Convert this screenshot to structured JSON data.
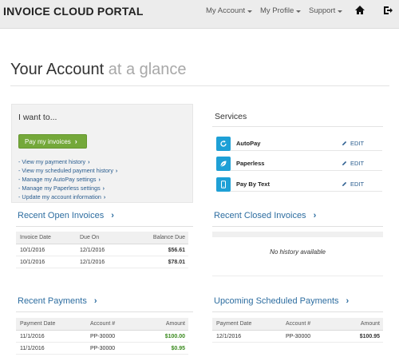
{
  "nav": {
    "brand": "INVOICE CLOUD PORTAL",
    "items": [
      {
        "label": "My Account"
      },
      {
        "label": "My Profile"
      },
      {
        "label": "Support"
      }
    ],
    "icons": {
      "home": "home-icon",
      "logout": "logout-icon"
    }
  },
  "page": {
    "title_main": "Your Account",
    "title_muted": "at a glance"
  },
  "want": {
    "title": "I want to...",
    "pay_button": "Pay my invoices",
    "links": [
      "- View my payment history",
      "- View my scheduled payment history",
      "- Manage my AutoPay settings",
      "- Manage my Paperless settings",
      "- Update my account information"
    ]
  },
  "services": {
    "title": "Services",
    "items": [
      {
        "name": "AutoPay",
        "edit": "EDIT",
        "icon": "refresh-icon"
      },
      {
        "name": "Paperless",
        "edit": "EDIT",
        "icon": "leaf-icon"
      },
      {
        "name": "Pay By Text",
        "edit": "EDIT",
        "icon": "phone-icon"
      }
    ]
  },
  "open_invoices": {
    "title": "Recent Open Invoices",
    "columns": [
      "Invoice Date",
      "Due On",
      "Balance Due"
    ],
    "rows": [
      [
        "10/1/2016",
        "12/1/2016",
        "$56.61"
      ],
      [
        "10/1/2016",
        "12/1/2016",
        "$78.01"
      ]
    ]
  },
  "closed_invoices": {
    "title": "Recent Closed Invoices",
    "empty_text": "No history available"
  },
  "payments": {
    "title": "Recent Payments",
    "columns": [
      "Payment Date",
      "Account #",
      "Amount"
    ],
    "rows": [
      [
        "11/1/2016",
        "PP-30000",
        "$100.00"
      ],
      [
        "11/1/2016",
        "PP-30000",
        "$0.95"
      ]
    ]
  },
  "scheduled": {
    "title": "Upcoming Scheduled Payments",
    "columns": [
      "Payment Date",
      "Account #",
      "Amount"
    ],
    "rows": [
      [
        "12/1/2016",
        "PP-30000",
        "$100.95"
      ]
    ]
  },
  "colors": {
    "accent_blue": "#2d6da0",
    "service_icon": "#1ea0d6",
    "pay_button": "#74a83a",
    "amount_green": "#3a8a1e"
  }
}
